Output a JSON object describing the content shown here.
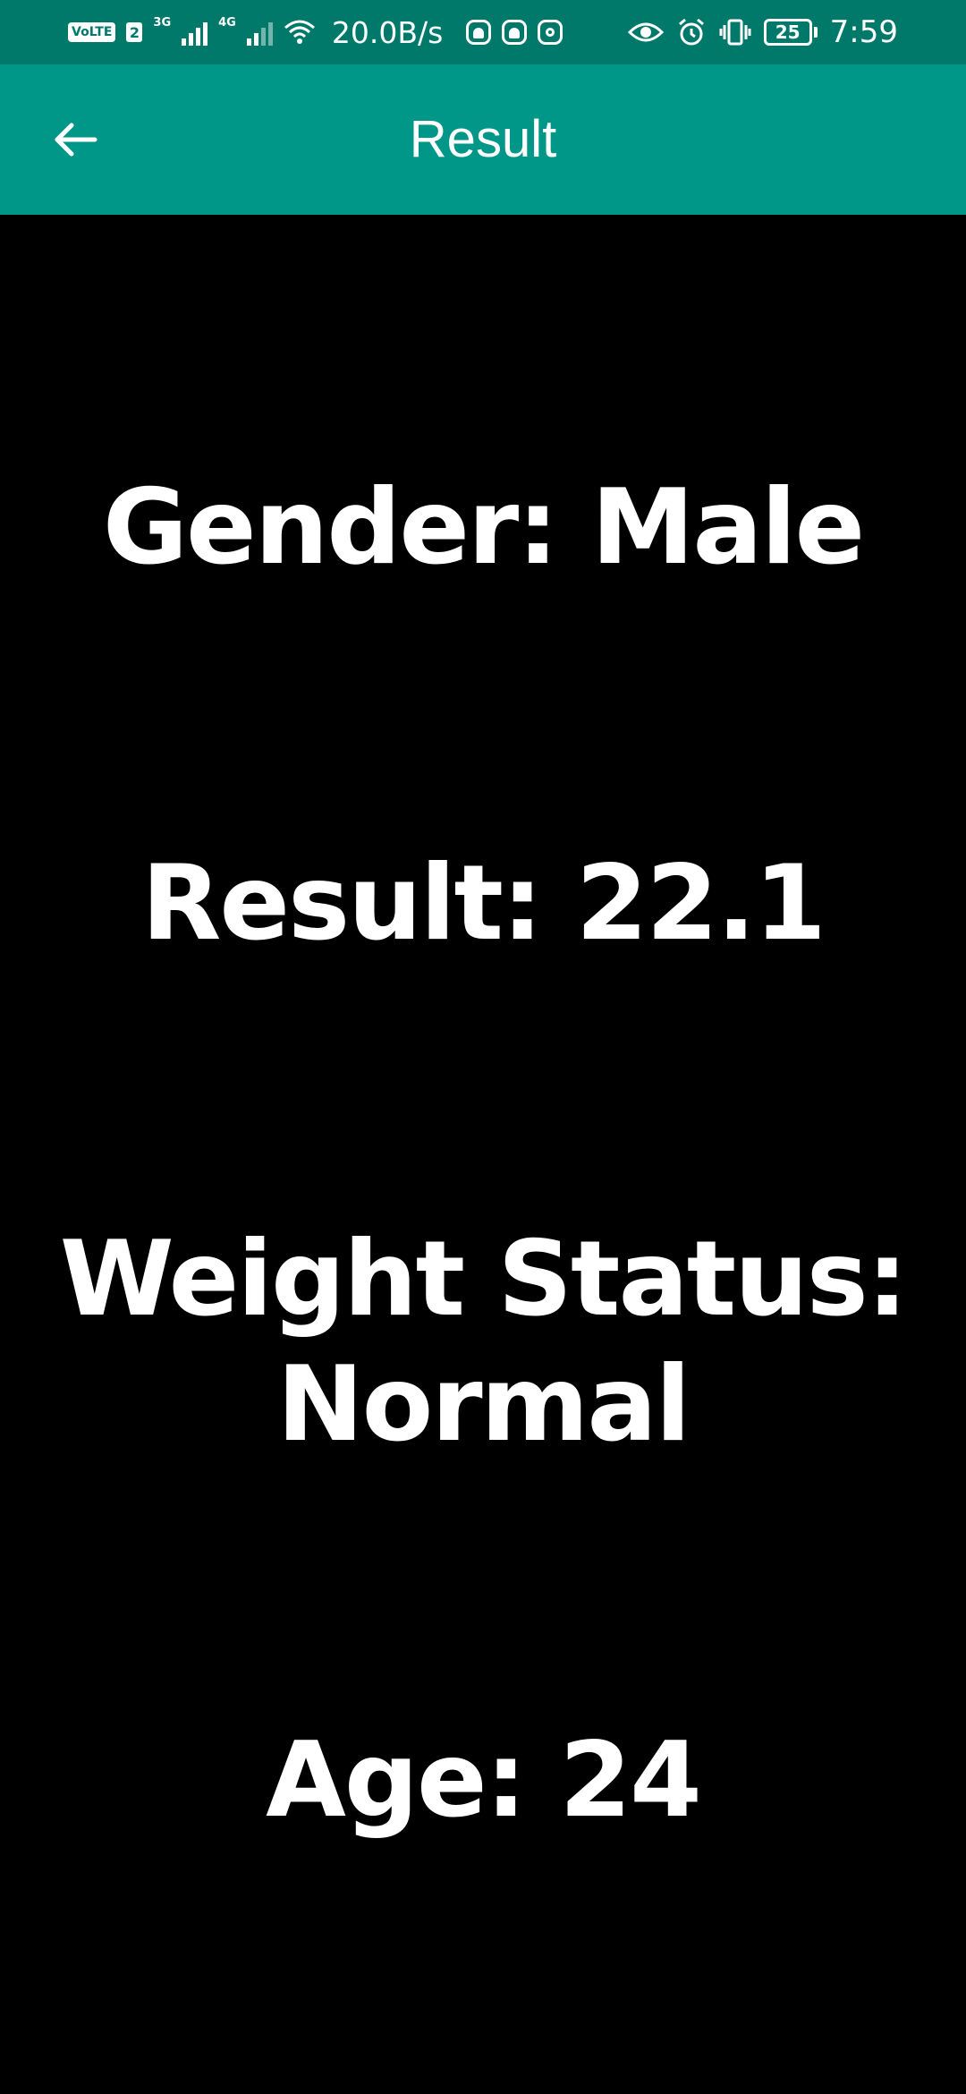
{
  "status_bar": {
    "volte": "VoLTE",
    "sim": "2",
    "net1": "3G",
    "net2": "4G",
    "speed": "20.0B/s",
    "battery": "25",
    "time": "7:59"
  },
  "app_bar": {
    "title": "Result"
  },
  "results": {
    "gender": "Gender: Male",
    "result": "Result: 22.1",
    "weight_status_line1": "Weight Status:",
    "weight_status_line2": "Normal",
    "age": "Age: 24"
  },
  "colors": {
    "status_bar_bg": "#00796B",
    "app_bar_bg": "#009688",
    "content_bg": "#000000",
    "text": "#FFFFFF"
  }
}
